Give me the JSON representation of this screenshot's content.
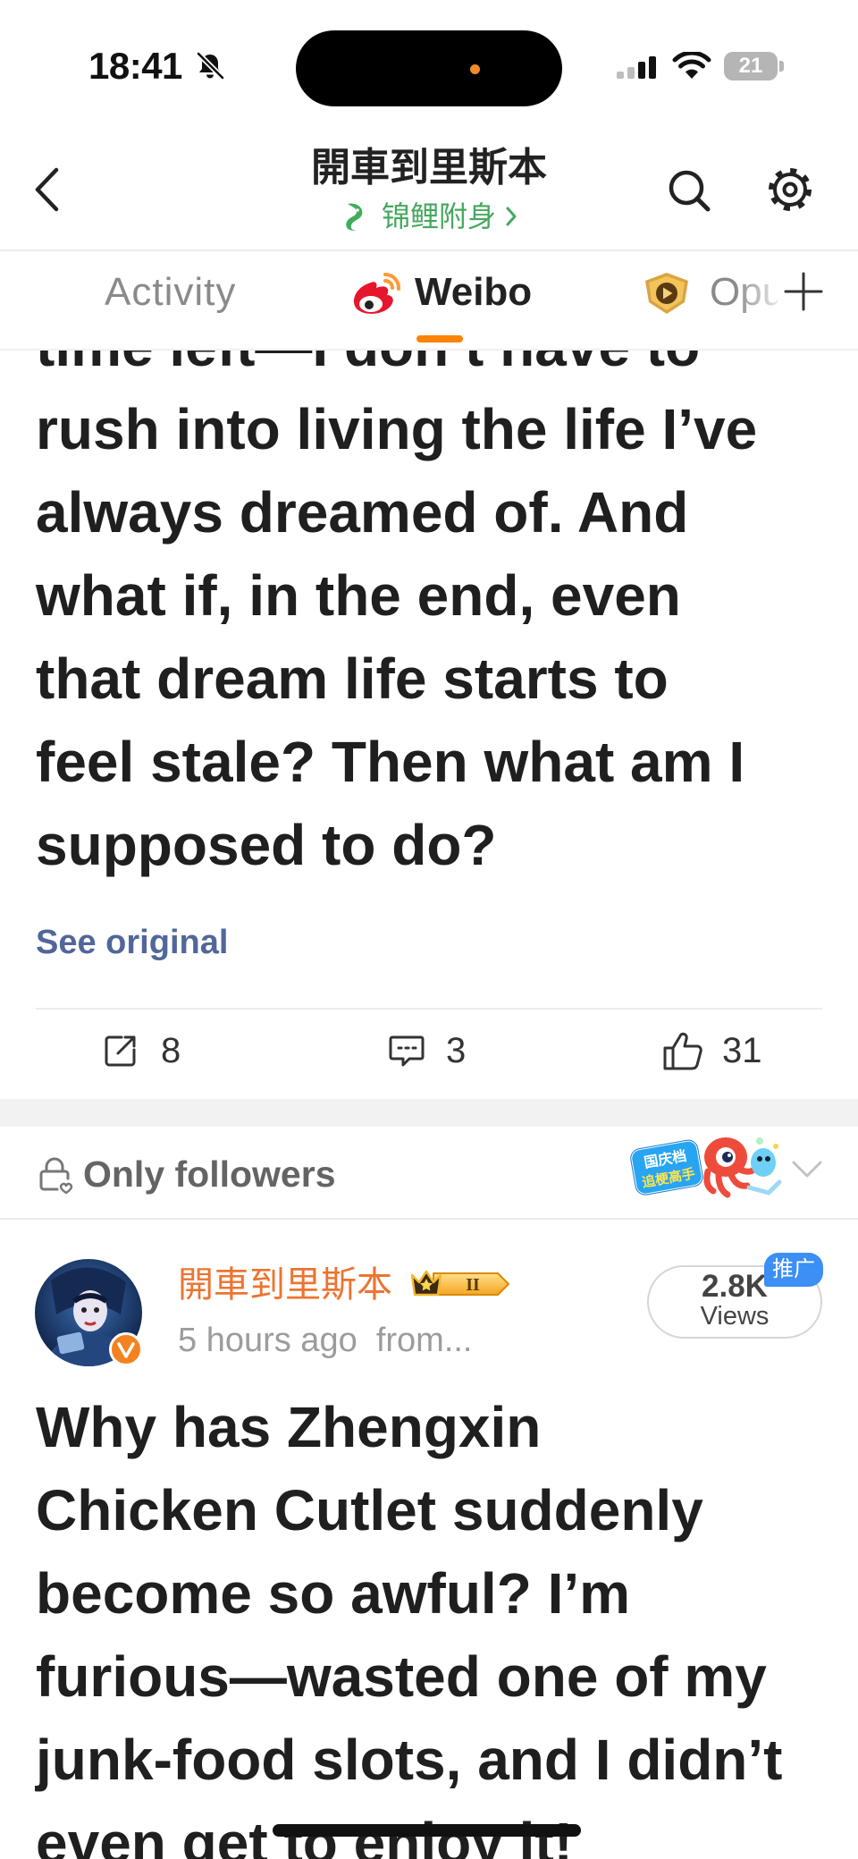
{
  "status_bar": {
    "time": "18:41",
    "battery": "21",
    "icons": [
      "bell-slash-icon",
      "signal-icon",
      "wifi-icon",
      "battery-icon"
    ]
  },
  "header": {
    "title": "開車到里斯本",
    "subtitle": "锦鲤附身",
    "icons": {
      "back": "chevron-left-icon",
      "subtitle": "koi-icon",
      "subtitle_arrow": "chevron-right-icon",
      "search": "search-icon",
      "settings": "gear-icon"
    }
  },
  "tabs": {
    "items": [
      {
        "label": "Activity",
        "active": false
      },
      {
        "label": "Weibo",
        "active": true,
        "icon": "weibo-logo-icon"
      },
      {
        "label": "Opus",
        "active": false,
        "icon": "opus-icon"
      }
    ],
    "add_icon": "plus-icon"
  },
  "post1": {
    "lines": [
      "time left—I don’t have to",
      "rush into living the life I’ve",
      "always dreamed of. And",
      "what if, in the end, even",
      "that dream life starts to",
      "feel stale? Then what am I",
      "supposed to do?"
    ],
    "see_original": "See original",
    "actions": {
      "reposts": "8",
      "comments": "3",
      "likes": "31"
    }
  },
  "visibility": {
    "label": "Only followers",
    "icon": "lock-icon",
    "sticker": {
      "line1": "国庆档",
      "line2": "追梗高手"
    },
    "expand_icon": "chevron-down-icon"
  },
  "post2": {
    "author": "開車到里斯本",
    "badge_level": "II",
    "meta": "5 hours ago  from...",
    "views": {
      "count": "2.8K",
      "label": "Views",
      "tag": "推广"
    },
    "lines": [
      "Why has Zhengxin",
      "Chicken Cutlet suddenly",
      "become so awful? I’m",
      "furious—wasted one of my",
      "junk-food slots, and I didn’t",
      "even get to enjoy it!"
    ]
  },
  "colors": {
    "tab_accent": "#ff8200",
    "link": "#51669a",
    "author_name": "#ec7430",
    "subtitle_green": "#45a85e",
    "promo_tag": "#3b8ff5",
    "verified_badge": "#f58220"
  }
}
